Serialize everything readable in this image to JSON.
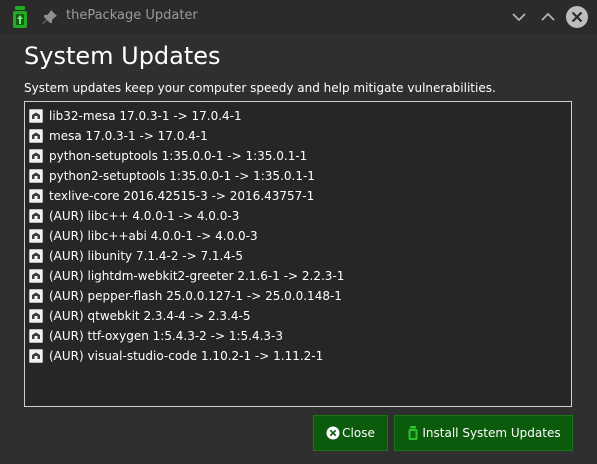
{
  "window": {
    "title": "thePackage Updater",
    "icons": [
      "app-icon",
      "pin-icon",
      "minimize-icon",
      "maximize-icon",
      "close-icon"
    ]
  },
  "header": {
    "title": "System Updates",
    "subtitle": "System updates keep your computer speedy and help mitigate vulnerabilities."
  },
  "updates": [
    "lib32-mesa 17.0.3-1 -> 17.0.4-1",
    "mesa 17.0.3-1 -> 17.0.4-1",
    "python-setuptools 1:35.0.0-1 -> 1:35.0.1-1",
    "python2-setuptools 1:35.0.0-1 -> 1:35.0.1-1",
    "texlive-core 2016.42515-3 -> 2016.43757-1",
    "(AUR) libc++ 4.0.0-1 -> 4.0.0-3",
    "(AUR) libc++abi 4.0.0-1 -> 4.0.0-3",
    "(AUR) libunity 7.1.4-2 -> 7.1.4-5",
    "(AUR) lightdm-webkit2-greeter 2.1.6-1 -> 2.2.3-1",
    "(AUR) pepper-flash 25.0.0.127-1 -> 25.0.0.148-1",
    "(AUR) qtwebkit 2.3.4-4 -> 2.3.4-5",
    "(AUR) ttf-oxygen 1:5.4.3-2 -> 1:5.4.3-3",
    "(AUR) visual-studio-code 1.10.2-1 -> 1.11.2-1"
  ],
  "buttons": {
    "close_label": "Close",
    "install_label": "Install System Updates"
  },
  "colors": {
    "window_bg": "#2f2f2f",
    "button_green": "#0c5b0c",
    "app_icon_green": "#1fa31f"
  }
}
